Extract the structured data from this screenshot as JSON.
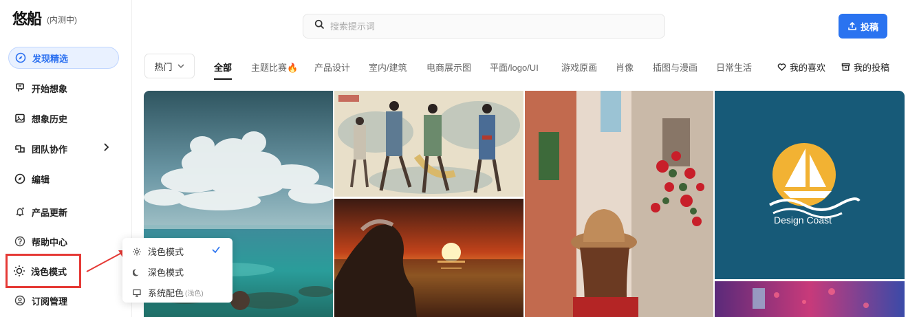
{
  "brand": {
    "logo": "悠船",
    "tag": "(内测中)"
  },
  "sidebar": {
    "items": [
      {
        "label": "发现精选",
        "icon": "compass-icon",
        "active": true
      },
      {
        "label": "开始想象",
        "icon": "brush-icon"
      },
      {
        "label": "想象历史",
        "icon": "image-icon"
      },
      {
        "label": "团队协作",
        "icon": "team-icon"
      },
      {
        "label": "编辑",
        "icon": "compass-icon"
      },
      {
        "label": "产品更新",
        "icon": "bell-icon"
      },
      {
        "label": "帮助中心",
        "icon": "help-icon"
      },
      {
        "label": "浅色模式",
        "icon": "sun-icon"
      },
      {
        "label": "订阅管理",
        "icon": "user-icon"
      }
    ]
  },
  "search": {
    "placeholder": "搜索提示词"
  },
  "upload": {
    "label": "投稿"
  },
  "sort": {
    "label": "热门"
  },
  "tabs": [
    "全部",
    "主题比赛🔥",
    "产品设计",
    "室内/建筑",
    "电商展示图",
    "平面/logo/UI",
    "游戏原画",
    "肖像",
    "插图与漫画",
    "日常生活"
  ],
  "right_links": {
    "likes": "我的喜欢",
    "submissions": "我的投稿"
  },
  "gallery": {
    "logo_text": "Design Coast"
  },
  "theme_menu": {
    "items": [
      {
        "label": "浅色模式",
        "selected": true
      },
      {
        "label": "深色模式"
      },
      {
        "label": "系统配色",
        "note": "(浅色)"
      }
    ]
  },
  "colors": {
    "accent": "#2a73f0",
    "highlight": "#e53935",
    "active_bg": "#e9f1ff"
  }
}
